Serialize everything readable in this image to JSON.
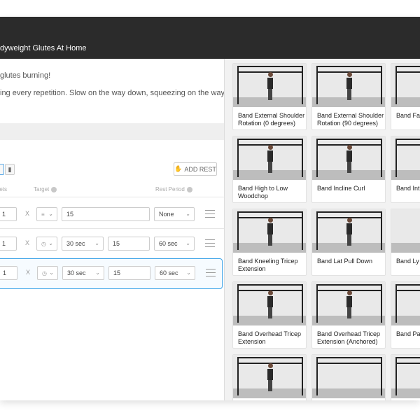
{
  "header": {
    "title": "dyweight Glutes At Home"
  },
  "description": {
    "line1": "glutes burning!",
    "line2": "ing every repetition. Slow on the way down, squeezing on the way back"
  },
  "toolbar": {
    "add_rest_label": "ADD REST"
  },
  "columns": {
    "sets": "Sets",
    "target": "Target",
    "rest_period": "Rest Period"
  },
  "sets": [
    {
      "set_value": "1",
      "x_label": "X",
      "target_value": "15",
      "rest": "None"
    },
    {
      "set_value": "1",
      "x_label": "X",
      "duration": "30 sec",
      "target_value": "15",
      "rest": "60 sec"
    },
    {
      "set_value": "1",
      "x_label": "X",
      "duration": "30 sec",
      "target_value": "15",
      "rest": "60 sec"
    }
  ],
  "exercises": [
    {
      "title": "Band External Shoulder Rotation (0 degrees)"
    },
    {
      "title": "Band External Shoulder Rotation (90 degrees)"
    },
    {
      "title": "Band Fa"
    },
    {
      "title": "Band High to Low Woodchop"
    },
    {
      "title": "Band Incline Curl"
    },
    {
      "title": "Band Int Shoulde"
    },
    {
      "title": "Band Kneeling Tricep Extension"
    },
    {
      "title": "Band Lat Pull Down"
    },
    {
      "title": "Band Ly Press"
    },
    {
      "title": "Band Overhead Tricep Extension"
    },
    {
      "title": "Band Overhead Tricep Extension (Anchored)"
    },
    {
      "title": "Band Pa"
    },
    {
      "title": ""
    },
    {
      "title": ""
    },
    {
      "title": ""
    }
  ],
  "colors": {
    "header_bg": "#2b2b2b",
    "accent": "#3ba3e8",
    "panel_bg": "#f2f2f2"
  }
}
